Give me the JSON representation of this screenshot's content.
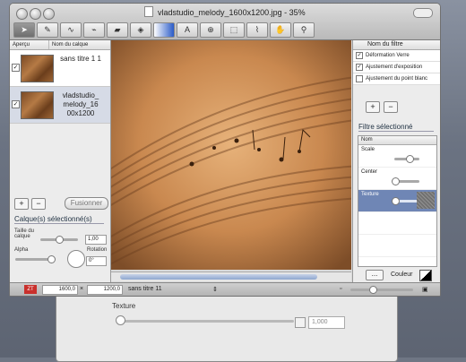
{
  "window": {
    "title": "vladstudio_melody_1600x1200.jpg - 35%",
    "tools": [
      "pointer",
      "brush",
      "pen",
      "paint",
      "eraser",
      "stamp",
      "gradient",
      "text",
      "crop",
      "select",
      "lasso",
      "hand",
      "zoom"
    ]
  },
  "layers_panel": {
    "col_preview": "Aperçu",
    "col_name": "Nom du calque",
    "layers": [
      {
        "name": "sans titre 1 1",
        "checked": "✓"
      },
      {
        "name": "vladstudio_ melody_16 00x1200",
        "checked": "✓"
      }
    ],
    "add": "+",
    "remove": "−",
    "merge": "Fusionner",
    "selected_title": "Calque(s) sélectionné(s)",
    "size_label": "Taille du calque",
    "size_value": "1,00",
    "size_level": 0.5,
    "alpha_label": "Alpha",
    "alpha_level": 1.0,
    "rotation_label": "Rotation",
    "rotation_value": "0°"
  },
  "filters_panel": {
    "header": "Nom du filtre",
    "filters": [
      {
        "name": "Déformation Verre",
        "checked": "✓"
      },
      {
        "name": "Ajustement d'exposition",
        "checked": "✓"
      },
      {
        "name": "Ajustement du point blanc",
        "checked": ""
      }
    ],
    "add": "+",
    "remove": "−",
    "selected_title": "Filtre sélectionné",
    "params_header": "Nom",
    "params": [
      {
        "name": "Scale",
        "level": 0.6
      },
      {
        "name": "Center",
        "level": 0.05
      },
      {
        "name": "Texture",
        "level": 0.05
      }
    ],
    "more": "...",
    "color_label": "Couleur"
  },
  "status_bar": {
    "badge": "ZT",
    "width": "1600,0",
    "height": "1200,0",
    "layer_name": "sans titre 11",
    "zoom_level": 0.35
  },
  "background_window": {
    "label": "Texture",
    "value": "1,000"
  }
}
